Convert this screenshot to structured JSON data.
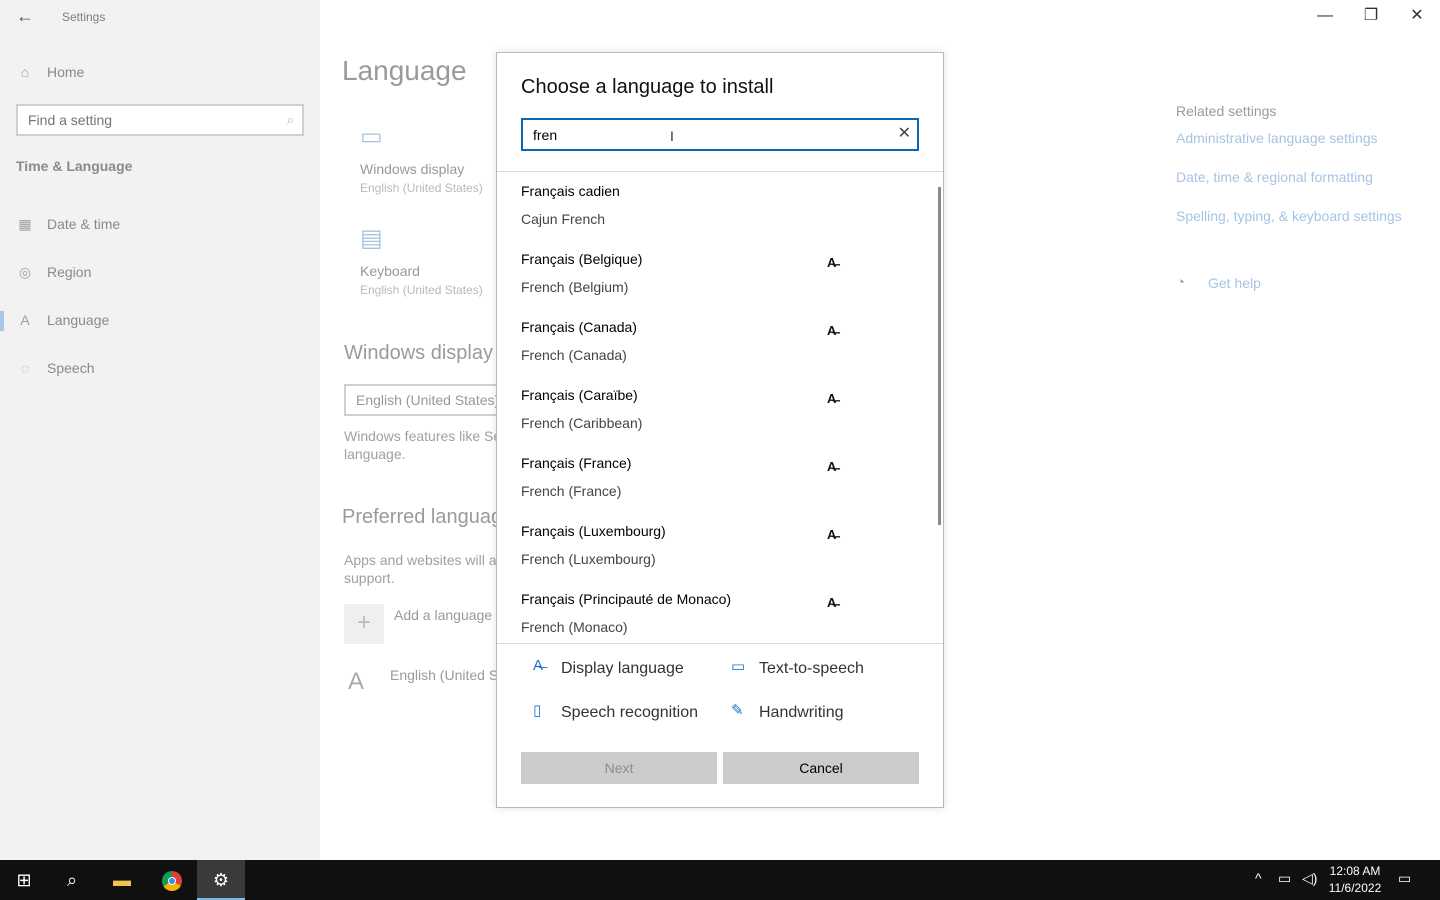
{
  "window": {
    "title": "Settings",
    "controls": [
      "minimize",
      "restore",
      "close"
    ]
  },
  "sidebar": {
    "home_label": "Home",
    "search_placeholder": "Find a setting",
    "section_title": "Time & Language",
    "items": [
      {
        "label": "Date & time",
        "icon": "calendar-clock-icon",
        "active": false
      },
      {
        "label": "Region",
        "icon": "globe-icon",
        "active": false
      },
      {
        "label": "Language",
        "icon": "language-icon",
        "active": true
      },
      {
        "label": "Speech",
        "icon": "microphone-icon",
        "active": false
      }
    ]
  },
  "main": {
    "page_title": "Language",
    "tiles": [
      {
        "title": "Windows display",
        "subtitle": "English (United States)",
        "icon": "monitor-icon"
      },
      {
        "title": "Keyboard",
        "subtitle": "English (United States)",
        "icon": "keyboard-icon"
      }
    ],
    "windows_display_heading": "Windows display",
    "display_dropdown_value": "English (United States)",
    "display_desc_line1": "Windows features like Se",
    "display_desc_line2": "language.",
    "preferred_heading": "Preferred languag",
    "preferred_desc_line1": "Apps and websites will a",
    "preferred_desc_line2": "support.",
    "add_language_label": "Add a language",
    "installed_language": "English (United St"
  },
  "related": {
    "heading": "Related settings",
    "links": [
      "Administrative language settings",
      "Date, time & regional formatting",
      "Spelling, typing, & keyboard settings"
    ],
    "get_help": "Get help"
  },
  "dialog": {
    "title": "Choose a language to install",
    "search_value": "fren",
    "languages": [
      {
        "native": "Français cadien",
        "english": "Cajun French",
        "display_lang": false
      },
      {
        "native": "Français (Belgique)",
        "english": "French (Belgium)",
        "display_lang": true
      },
      {
        "native": "Français (Canada)",
        "english": "French (Canada)",
        "display_lang": true
      },
      {
        "native": "Français (Caraïbe)",
        "english": "French (Caribbean)",
        "display_lang": true
      },
      {
        "native": "Français (France)",
        "english": "French (France)",
        "display_lang": true
      },
      {
        "native": "Français (Luxembourg)",
        "english": "French (Luxembourg)",
        "display_lang": true
      },
      {
        "native": "Français (Principauté de Monaco)",
        "english": "French (Monaco)",
        "display_lang": true
      }
    ],
    "legend": {
      "display_language": "Display language",
      "text_to_speech": "Text-to-speech",
      "speech_recognition": "Speech recognition",
      "handwriting": "Handwriting"
    },
    "next_label": "Next",
    "cancel_label": "Cancel"
  },
  "taskbar": {
    "time": "12:08 AM",
    "date": "11/6/2022"
  },
  "colors": {
    "accent": "#0a66b9",
    "taskbar": "#101010",
    "sidebar_bg": "#f2f2f2",
    "link_dimmed": "#a5c4e3"
  }
}
